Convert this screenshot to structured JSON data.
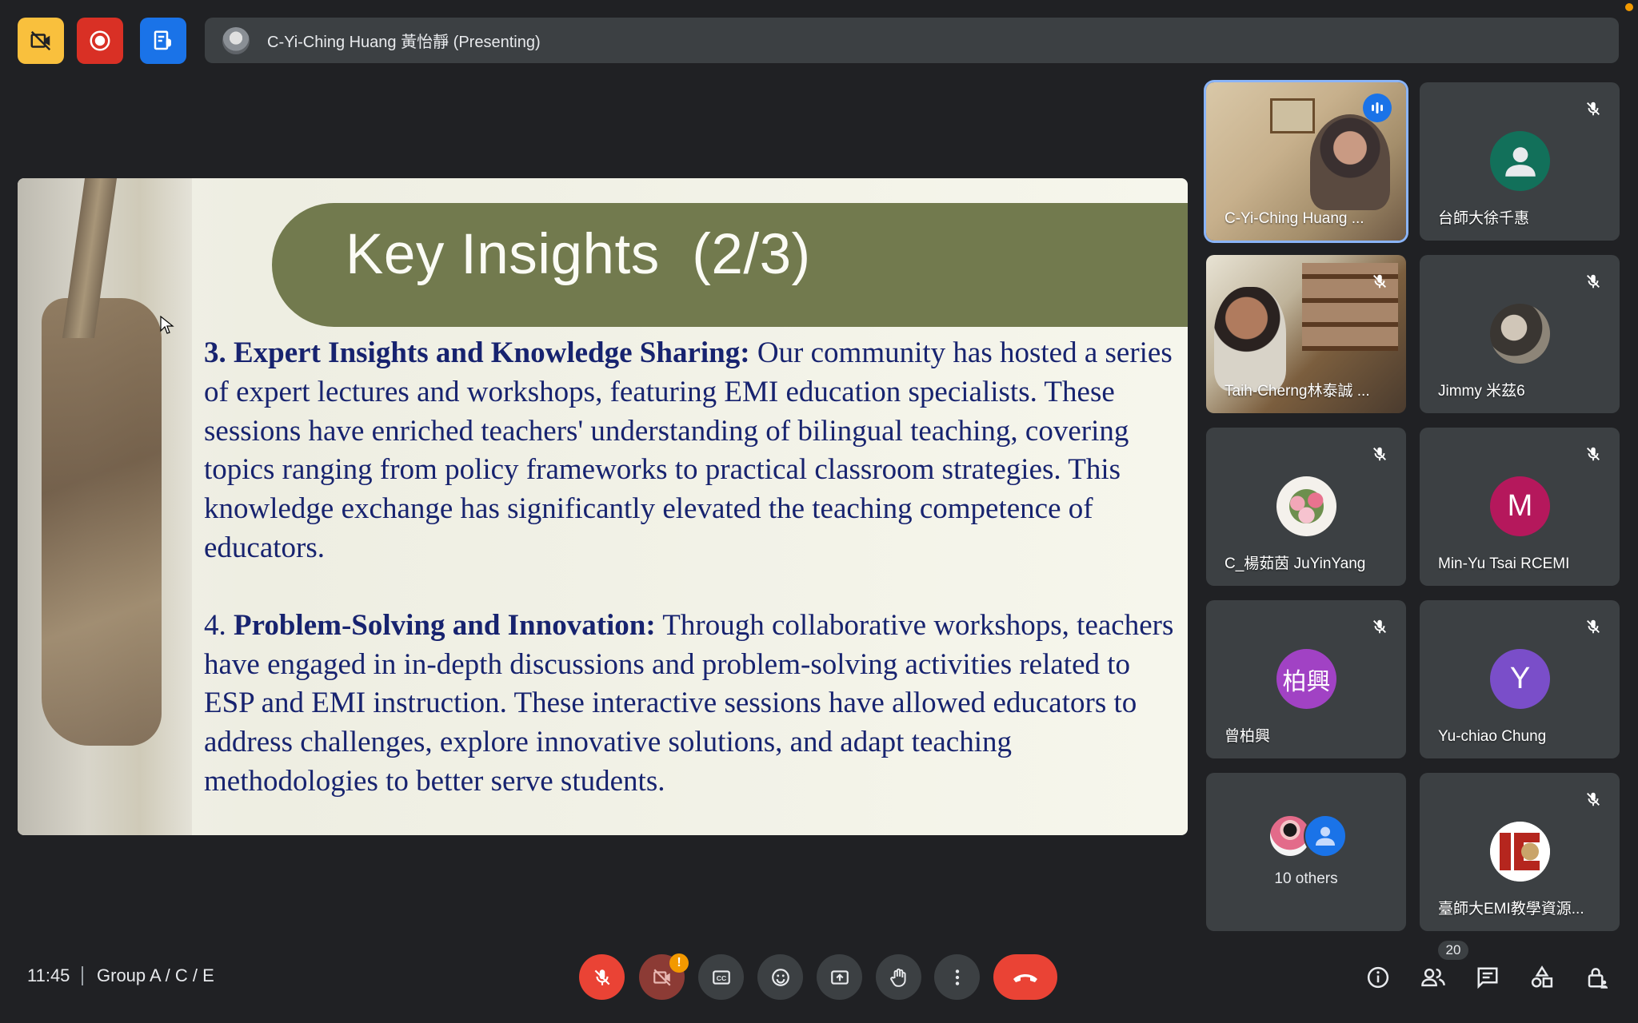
{
  "top_bar": {
    "presenter_text": "C-Yi-Ching Huang 黃怡靜 (Presenting)"
  },
  "slide": {
    "title": "Key Insights  (2/3)",
    "p1_heading": "3. Expert Insights and Knowledge Sharing:",
    "p1_text": " Our community has hosted a series of expert lectures and workshops, featuring EMI education specialists. These sessions have enriched teachers' understanding of bilingual teaching, covering topics ranging from policy frameworks to practical classroom strategies. This knowledge exchange has significantly elevated the teaching competence of educators.",
    "p2_number": "4. ",
    "p2_heading": "Problem-Solving and Innovation:",
    "p2_text": " Through collaborative workshops, teachers have engaged in in-depth discussions and problem-solving activities related to ESP and EMI instruction. These interactive sessions have allowed educators to address challenges, explore innovative solutions, and adapt teaching methodologies to better serve students."
  },
  "participants": [
    {
      "name": "C-Yi-Ching Huang ...",
      "type": "video",
      "speaking": true
    },
    {
      "name": "台師大徐千惠",
      "type": "avatar-generic",
      "muted": true
    },
    {
      "name": "Taih-Cherng林泰誠 ...",
      "type": "video",
      "muted": true
    },
    {
      "name": "Jimmy 米茲6",
      "type": "avatar-photo",
      "muted": true
    },
    {
      "name": "C_楊茹茵 JuYinYang",
      "type": "avatar-photo",
      "muted": true
    },
    {
      "name": "Min-Yu Tsai RCEMI",
      "initial": "M",
      "color": "#b5185c",
      "muted": true
    },
    {
      "name": "曾柏興",
      "initial": "柏興",
      "color": "#a142c4",
      "muted": true
    },
    {
      "name": "Yu-chiao Chung",
      "initial": "Y",
      "color": "#7a4ec9",
      "muted": true
    },
    {
      "name": "10 others",
      "type": "others"
    },
    {
      "name": "臺師大EMI教學資源...",
      "type": "avatar-logo",
      "muted": true
    }
  ],
  "bottom_bar": {
    "time": "11:45",
    "meeting_name": "Group A / C / E",
    "camera_warning": "!",
    "participant_count": "20"
  },
  "colors": {
    "background": "#202124",
    "tile": "#3c4043",
    "red": "#ea4335",
    "blue": "#1a73e8",
    "slide_header": "#727a4e",
    "slide_text": "#17236f"
  }
}
